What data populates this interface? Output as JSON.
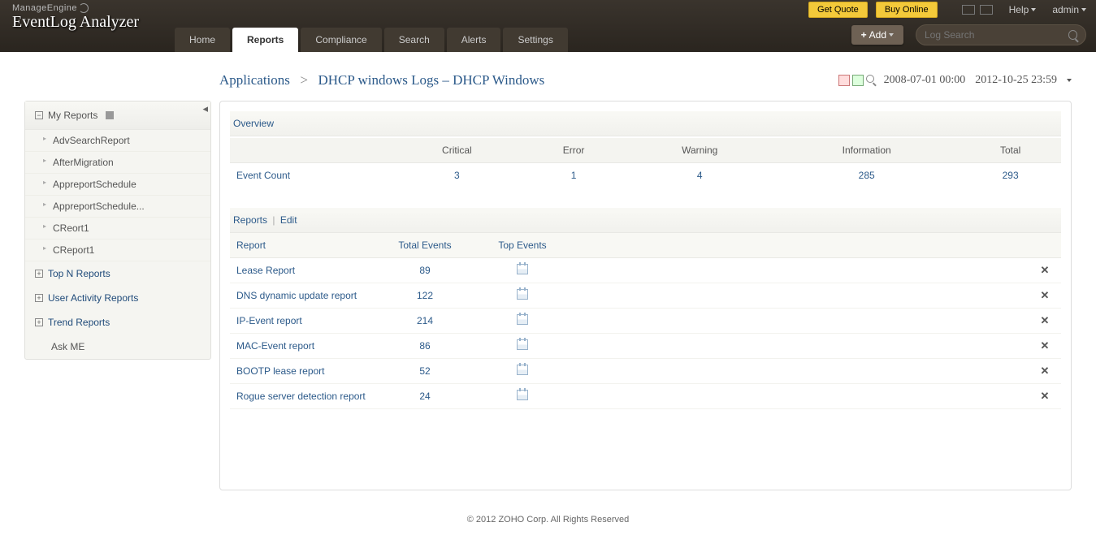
{
  "header": {
    "logo_top": "ManageEngine",
    "logo_main": "EventLog Analyzer",
    "get_quote": "Get Quote",
    "buy_online": "Buy Online",
    "help": "Help",
    "admin": "admin",
    "nav": [
      "Home",
      "Reports",
      "Compliance",
      "Search",
      "Alerts",
      "Settings"
    ],
    "active_nav": 1,
    "add_btn": "Add",
    "search_placeholder": "Log Search"
  },
  "breadcrumb": {
    "root": "Applications",
    "page": "DHCP windows Logs – DHCP Windows"
  },
  "dates": {
    "from": "2008-07-01 00:00",
    "to": "2012-10-25 23:59"
  },
  "sidebar": {
    "collapse": "◂",
    "my_reports": "My Reports",
    "my_items": [
      "AdvSearchReport",
      "AfterMigration",
      "AppreportSchedule",
      "AppreportSchedule...",
      "CReort1",
      "CReport1"
    ],
    "top_n": "Top N Reports",
    "user_activity": "User Activity Reports",
    "trend": "Trend Reports",
    "ask_me": "Ask ME"
  },
  "overview": {
    "title": "Overview",
    "row_label": "Event Count",
    "cols": [
      "Critical",
      "Error",
      "Warning",
      "Information",
      "Total"
    ],
    "vals": [
      "3",
      "1",
      "4",
      "285",
      "293"
    ]
  },
  "reports": {
    "tab_reports": "Reports",
    "tab_edit": "Edit",
    "cols": {
      "report": "Report",
      "total": "Total Events",
      "top": "Top Events"
    },
    "rows": [
      {
        "name": "Lease Report",
        "total": "89"
      },
      {
        "name": "DNS dynamic update report",
        "total": "122"
      },
      {
        "name": "IP-Event report",
        "total": "214"
      },
      {
        "name": "MAC-Event report",
        "total": "86"
      },
      {
        "name": "BOOTP lease report",
        "total": "52"
      },
      {
        "name": "Rogue server detection report",
        "total": "24"
      }
    ]
  },
  "footer": "© 2012 ZOHO Corp. All Rights Reserved"
}
